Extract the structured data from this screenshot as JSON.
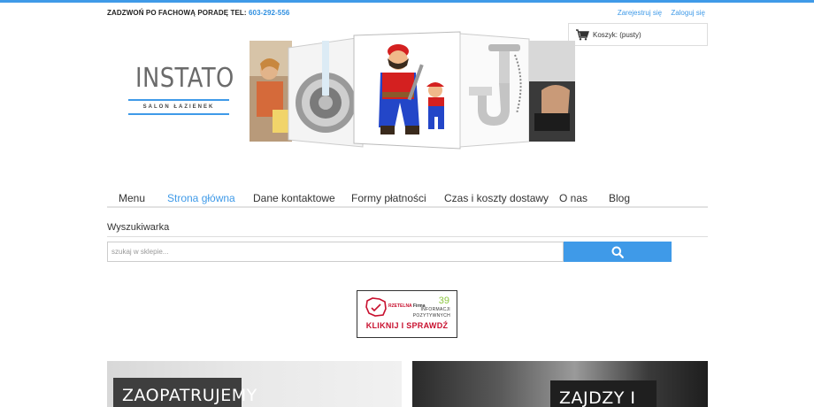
{
  "header": {
    "phone_prefix": "ZADZWOŃ PO FACHOWĄ PORADĘ TEL:",
    "phone_number": "603-292-556",
    "register_label": "Zarejestruj się",
    "login_label": "Zaloguj się",
    "cart_label": "Koszyk: (pusty)"
  },
  "logo": {
    "name": "INSTATO",
    "subtitle": "SALON ŁAZIENEK"
  },
  "nav": {
    "items": [
      {
        "label": "Menu",
        "active": false
      },
      {
        "label": "Strona główna",
        "active": true
      },
      {
        "label": "Dane kontaktowe",
        "active": false
      },
      {
        "label": "Formy płatności",
        "active": false
      },
      {
        "label": "Czas i koszty dostawy",
        "active": false
      },
      {
        "label": "O nas",
        "active": false
      },
      {
        "label": "Blog",
        "active": false
      }
    ]
  },
  "search": {
    "title": "Wyszukiwarka",
    "placeholder": "szukaj w sklepie..."
  },
  "badge": {
    "name_red": "RZETELNA",
    "name_dark": "Firma",
    "count": "39",
    "info_line1": "INFORMACJI",
    "info_line2": "POZYTYWNYCH",
    "cta": "KLIKNIJ I SPRAWDŹ"
  },
  "promos": [
    {
      "label": "ZAOPATRUJEMY"
    },
    {
      "label": "ZAJDZY I NA"
    }
  ],
  "colors": {
    "accent": "#3f9ae8",
    "badge_red": "#c8102e",
    "badge_green": "#8cc63f"
  }
}
